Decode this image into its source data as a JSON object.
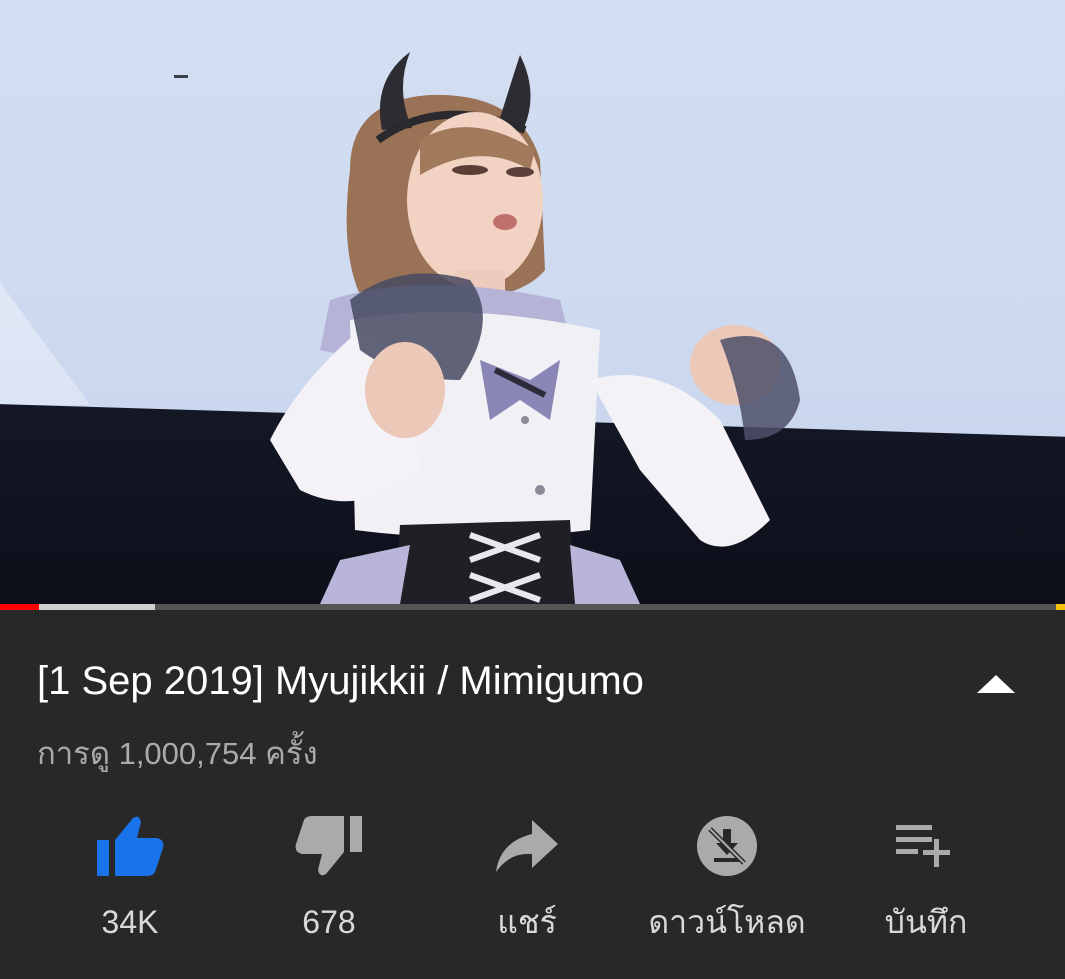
{
  "video": {
    "progress": {
      "played_fraction": 0.037,
      "buffered_fraction": 0.146
    }
  },
  "title": "[1 Sep 2019] Myujikkii / Mimigumo",
  "views": "การดู 1,000,754 ครั้ง",
  "actions": {
    "like": {
      "label": "34K",
      "icon": "thumb-up-icon",
      "color": "#1a73e8"
    },
    "dislike": {
      "label": "678",
      "icon": "thumb-down-icon"
    },
    "share": {
      "label": "แชร์",
      "icon": "share-arrow-icon"
    },
    "download": {
      "label": "ดาวน์โหลด",
      "icon": "download-disabled-icon"
    },
    "save": {
      "label": "บันทึก",
      "icon": "playlist-add-icon"
    }
  },
  "colors": {
    "background": "#282828",
    "accent_red": "#ff0000",
    "like_blue": "#1a73e8",
    "secondary_text": "#aaaaaa"
  }
}
